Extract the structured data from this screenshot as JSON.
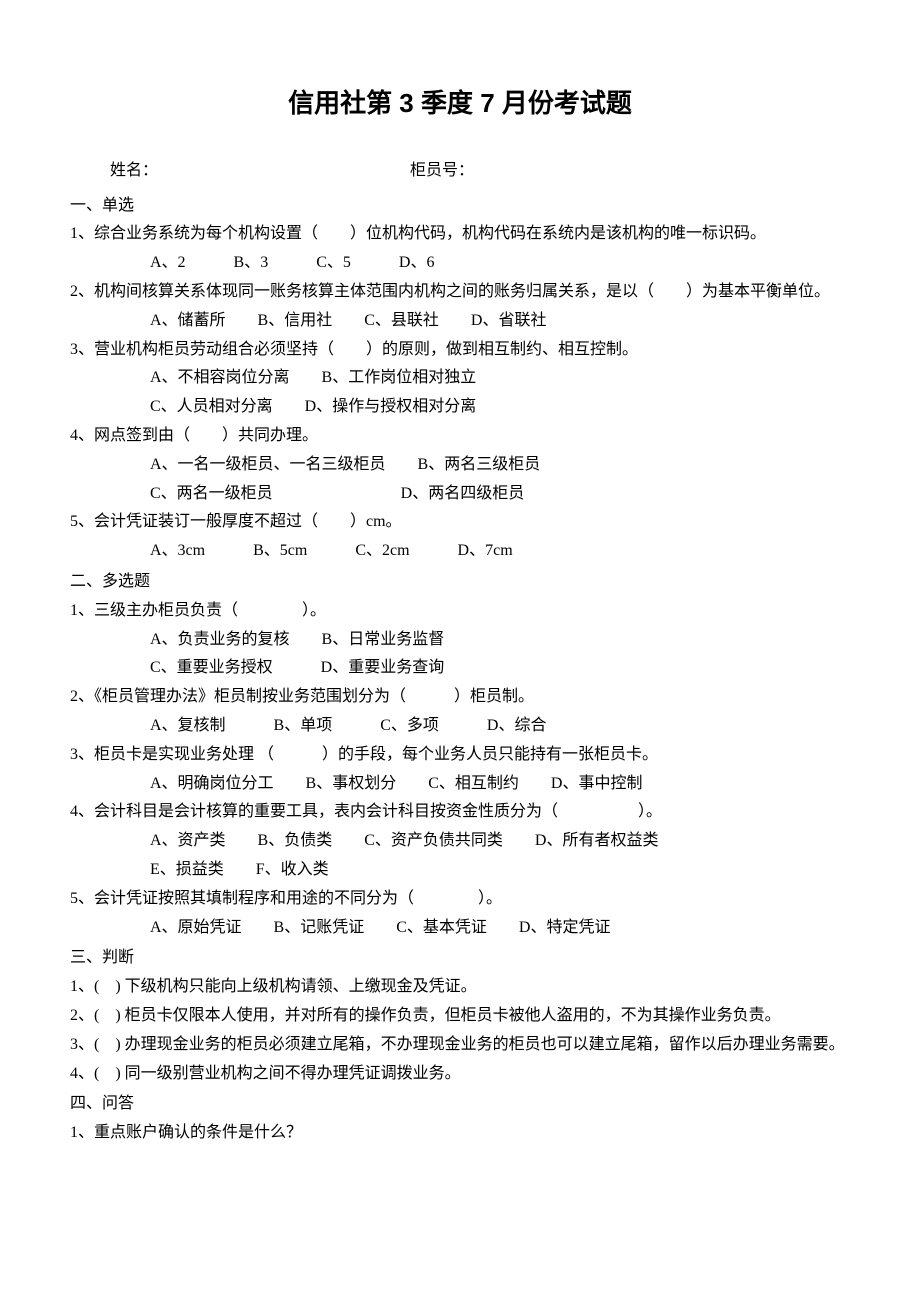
{
  "title": "信用社第 3 季度 7 月份考试题",
  "nameLabel": "姓名：",
  "tellerLabel": "柜员号：",
  "sec1": {
    "heading": "一、单选",
    "q1": "1、综合业务系统为每个机构设置（　　）位机构代码，机构代码在系统内是该机构的唯一标识码。",
    "q1opts": "A、2　　　B、3　　　C、5　　　D、6",
    "q2": "2、机构间核算关系体现同一账务核算主体范围内机构之间的账务归属关系，是以（　　）为基本平衡单位。",
    "q2opts": "A、储蓄所　　B、信用社　　C、县联社　　D、省联社",
    "q3": "3、营业机构柜员劳动组合必须坚持（　　）的原则，做到相互制约、相互控制。",
    "q3opts1": "A、不相容岗位分离　　B、工作岗位相对独立",
    "q3opts2": "C、人员相对分离　　D、操作与授权相对分离",
    "q4": "4、网点签到由（　　）共同办理。",
    "q4opts1": "A、一名一级柜员、一名三级柜员　　B、两名三级柜员",
    "q4opts2": "C、两名一级柜员　　　　　　　　D、两名四级柜员",
    "q5": "5、会计凭证装订一般厚度不超过（　　）cm。",
    "q5opts": "A、3cm　　　B、5cm　　　C、2cm　　　D、7cm"
  },
  "sec2": {
    "heading": "二、多选题",
    "q1": "1、三级主办柜员负责（　　　　）。",
    "q1opts1": "A、负责业务的复核　　B、日常业务监督",
    "q1opts2": "C、重要业务授权　　　D、重要业务查询",
    "q2": "2、《柜员管理办法》柜员制按业务范围划分为（　　　）柜员制。",
    "q2opts": "A、复核制　　　B、单项　　　C、多项　　　D、综合",
    "q3": "3、柜员卡是实现业务处理 （　　　）的手段，每个业务人员只能持有一张柜员卡。",
    "q3opts": "A、明确岗位分工　　B、事权划分　　C、相互制约　　D、事中控制",
    "q4": "4、会计科目是会计核算的重要工具，表内会计科目按资金性质分为（　　　　　）。",
    "q4opts1": "A、资产类　　B、负债类　　C、资产负债共同类　　D、所有者权益类",
    "q4opts2": "E、损益类　　F、收入类",
    "q5": "5、会计凭证按照其填制程序和用途的不同分为（　　　　）。",
    "q5opts": "A、原始凭证　　B、记账凭证　　C、基本凭证　　D、特定凭证"
  },
  "sec3": {
    "heading": "三、判断",
    "q1": "1、(　) 下级机构只能向上级机构请领、上缴现金及凭证。",
    "q2": "2、(　) 柜员卡仅限本人使用，并对所有的操作负责，但柜员卡被他人盗用的，不为其操作业务负责。",
    "q3": "3、(　) 办理现金业务的柜员必须建立尾箱，不办理现金业务的柜员也可以建立尾箱，留作以后办理业务需要。",
    "q4": "4、(　) 同一级别营业机构之间不得办理凭证调拨业务。"
  },
  "sec4": {
    "heading": "四、问答",
    "q1": "1、重点账户确认的条件是什么？"
  }
}
